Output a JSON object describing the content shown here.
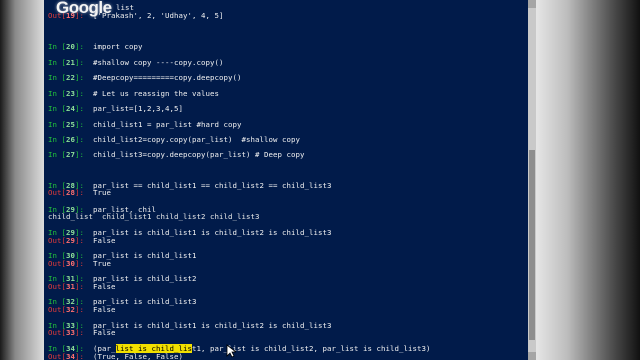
{
  "overlay": {
    "logo_text": "Google"
  },
  "console": {
    "top_partial_text": "list",
    "lines": [
      {
        "kind": "out",
        "num": "19",
        "code": "['Prakash', 2, 'Udhay', 4, 5]"
      },
      {
        "kind": "in",
        "num": "20",
        "code": "import copy"
      },
      {
        "kind": "in",
        "num": "21",
        "code": "#shallow copy ----copy.copy()"
      },
      {
        "kind": "in",
        "num": "22",
        "code": "#Deepcopy=========copy.deepcopy()"
      },
      {
        "kind": "in",
        "num": "23",
        "code": "# Let us reassign the values"
      },
      {
        "kind": "in",
        "num": "24",
        "code": "par_list=[1,2,3,4,5]"
      },
      {
        "kind": "in",
        "num": "25",
        "code": "child_list1 = par_list #hard copy"
      },
      {
        "kind": "in",
        "num": "26",
        "code": "child_list2=copy.copy(par_list)  #shallow copy"
      },
      {
        "kind": "in",
        "num": "27",
        "code": "child_list3=copy.deepcopy(par_list) # Deep copy"
      },
      {
        "kind": "in",
        "num": "28",
        "code": "par_list == child_list1 == child_list2 == child_list3"
      },
      {
        "kind": "out",
        "num": "28",
        "code": "True"
      },
      {
        "kind": "in",
        "num": "29",
        "code": "par_list, chil"
      },
      {
        "kind": "stray",
        "code": "child_list  child_list1 child_list2 child_list3"
      },
      {
        "kind": "in",
        "num": "29",
        "code": "par_list is child_list1 is child_list2 is child_list3"
      },
      {
        "kind": "out",
        "num": "29",
        "code": "False"
      },
      {
        "kind": "in",
        "num": "30",
        "code": "par_list is child_list1"
      },
      {
        "kind": "out",
        "num": "30",
        "code": "True"
      },
      {
        "kind": "in",
        "num": "31",
        "code": "par_list is child_list2"
      },
      {
        "kind": "out",
        "num": "31",
        "code": "False"
      },
      {
        "kind": "in",
        "num": "32",
        "code": "par_list is child_list3"
      },
      {
        "kind": "out",
        "num": "32",
        "code": "False"
      },
      {
        "kind": "in",
        "num": "33",
        "code": "par_list is child_list1 is child_list2 is child_list3"
      },
      {
        "kind": "out",
        "num": "33",
        "code": "False"
      },
      {
        "kind": "in",
        "num": "34",
        "code_before": "(par_",
        "code_selected": "list is child_lis",
        "code_after": "t1, par_list is child_list2, par_list is child_list3)"
      },
      {
        "kind": "out",
        "num": "34",
        "code": "(True, False, False)"
      }
    ]
  },
  "labels": {
    "in_prefix": "In [",
    "in_suffix": "]:",
    "out_prefix": "Out[",
    "out_suffix": "]:"
  }
}
